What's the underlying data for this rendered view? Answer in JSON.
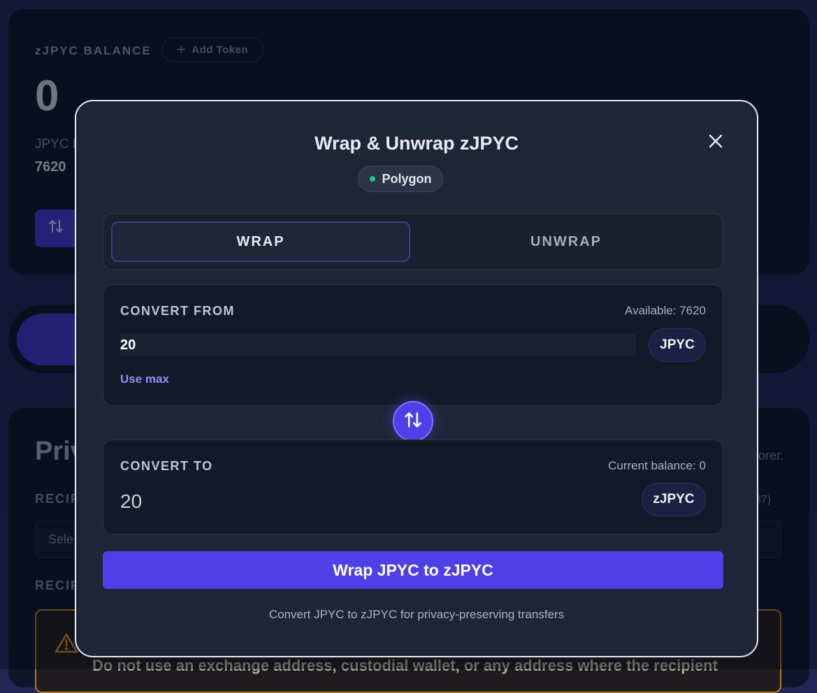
{
  "background": {
    "balance_label": "zJPYC BALANCE",
    "add_token_label": "Add Token",
    "balance_value": "0",
    "jpyc_label": "JPYC B",
    "jpyc_value": "7620",
    "private_title": "Priv",
    "explorer_suffix": "orer.",
    "recipient_label": "RECIP",
    "recipient_count": "37)",
    "select_placeholder": "Sele",
    "recipient_label_2": "RECIP",
    "warning_text": "Do not use an exchange address, custodial wallet, or any address where the recipient"
  },
  "modal": {
    "title": "Wrap & Unwrap zJPYC",
    "network": "Polygon",
    "tabs": [
      {
        "label": "WRAP",
        "active": true
      },
      {
        "label": "UNWRAP",
        "active": false
      }
    ],
    "from": {
      "label": "CONVERT FROM",
      "available": "Available: 7620",
      "amount": "20",
      "token": "JPYC",
      "use_max": "Use max"
    },
    "to": {
      "label": "CONVERT TO",
      "current_balance": "Current balance: 0",
      "amount": "20",
      "token": "zJPYC"
    },
    "primary_button": "Wrap JPYC to zJPYC",
    "footnote": "Convert JPYC to zJPYC for privacy-preserving transfers"
  },
  "colors": {
    "accent": "#4f3fe6",
    "network_dot": "#22c58b",
    "use_max": "#9b8cf3",
    "warning_border": "#b5791c"
  },
  "icons": {
    "close": "close-icon",
    "swap": "swap-arrows-icon",
    "plus": "plus-icon",
    "warning": "warning-triangle-icon"
  }
}
